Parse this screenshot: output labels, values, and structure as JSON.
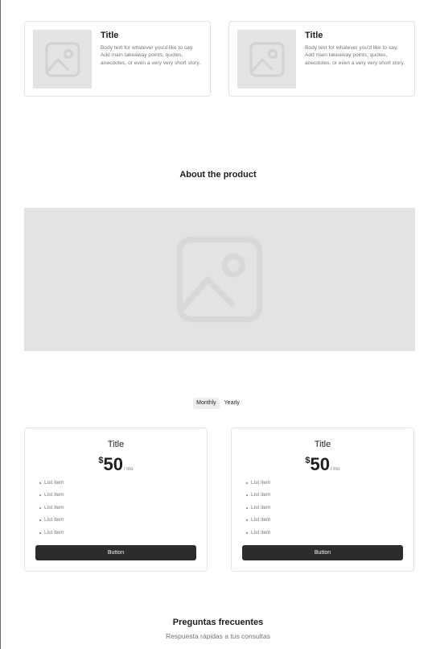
{
  "cards": [
    {
      "title": "Title",
      "body": "Body text for whatever you'd like to say. Add main takeaway points, quotes, anecdotes, or even a very very short story.",
      "icon": "image-placeholder-icon"
    },
    {
      "title": "Title",
      "body": "Body text for whatever you'd like to say. Add main takeaway points, quotes, anecdotes, or even a very very short story.",
      "icon": "image-placeholder-icon"
    }
  ],
  "about": {
    "heading": "About the product",
    "image_icon": "image-placeholder-icon"
  },
  "billing_toggle": {
    "options": [
      "Monthly",
      "Yearly"
    ],
    "selected": "Monthly"
  },
  "plans": [
    {
      "title": "Title",
      "currency": "$",
      "amount": "50",
      "period": "/ mo",
      "items": [
        "List item",
        "List item",
        "List item",
        "List item",
        "List item"
      ],
      "button": "Button"
    },
    {
      "title": "Title",
      "currency": "$",
      "amount": "50",
      "period": "/ mo",
      "items": [
        "List item",
        "List item",
        "List item",
        "List item",
        "List item"
      ],
      "button": "Button"
    }
  ],
  "faq": {
    "title": "Preguntas frecuentes",
    "subtitle": "Respuesta rápidas a tus consultas"
  },
  "colors": {
    "placeholder": "#e3e3e3",
    "button": "#2c2c2c",
    "text": "#1e1e1e",
    "muted": "#757575"
  }
}
